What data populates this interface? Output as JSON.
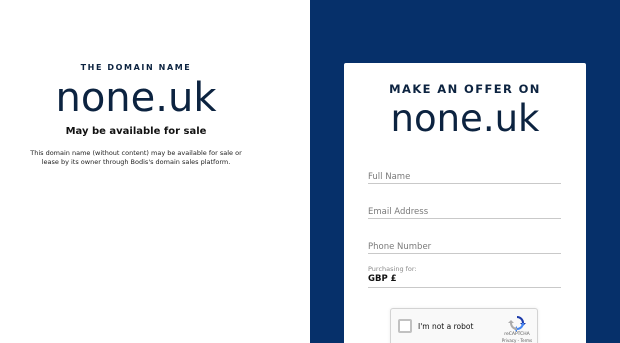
{
  "left": {
    "eyebrow": "THE DOMAIN NAME",
    "domain": "none.uk",
    "subhead": "May be available for sale",
    "description": "This domain name (without content) may be available for sale or lease by its owner through Bodis's domain sales platform."
  },
  "offer": {
    "title": "MAKE AN OFFER ON",
    "domain": "none.uk",
    "full_name_placeholder": "Full Name",
    "email_placeholder": "Email Address",
    "phone_placeholder": "Phone Number",
    "purchasing_label": "Purchasing for:",
    "currency_prefix": "GBP £"
  },
  "captcha": {
    "label": "I'm not a robot",
    "brand": "reCAPTCHA",
    "links": "Privacy - Terms",
    "icon": "recaptcha-logo"
  },
  "colors": {
    "brand_navy": "#06306a",
    "text_navy": "#0c2340"
  }
}
